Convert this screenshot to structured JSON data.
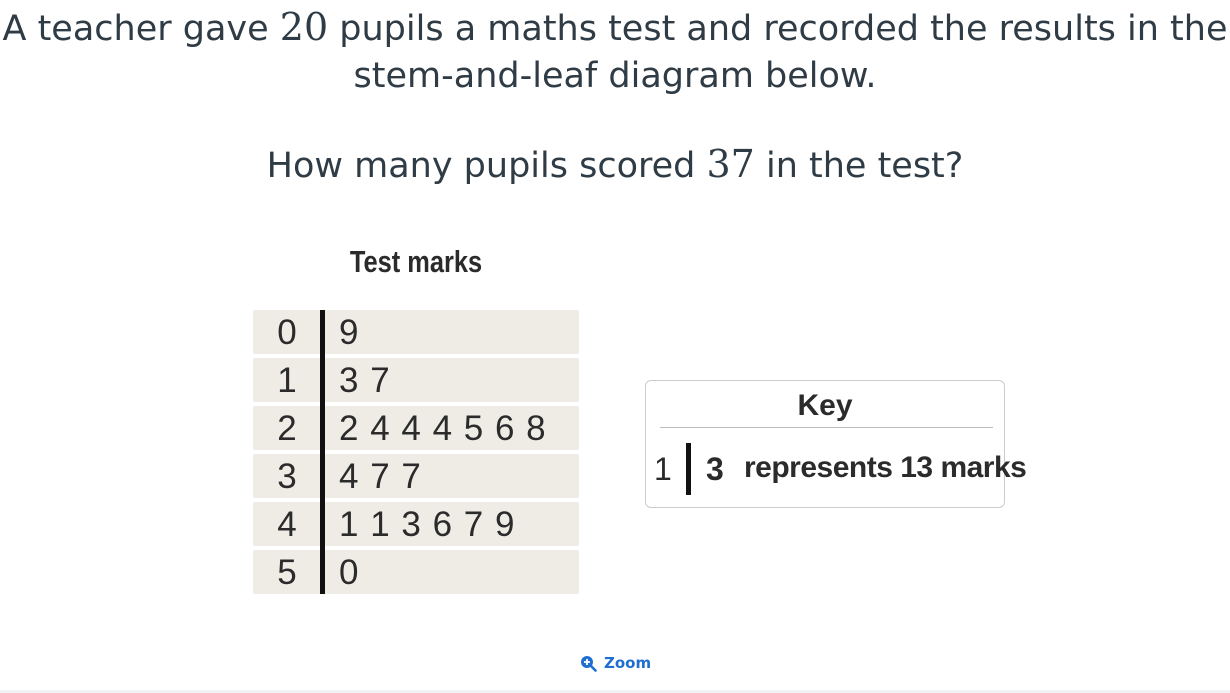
{
  "question": {
    "part1": "A teacher gave ",
    "number": "20",
    "part2": " pupils a maths test and recorded the results in the",
    "line2": "stem-and-leaf diagram below."
  },
  "prompt": {
    "part1": "How many pupils scored ",
    "number": "37",
    "part2": " in the test?"
  },
  "figure": {
    "title": "Test marks",
    "rows": [
      {
        "stem": "0",
        "leaves": "9"
      },
      {
        "stem": "1",
        "leaves": "3 7"
      },
      {
        "stem": "2",
        "leaves": "2 4 4 4 5 6 8"
      },
      {
        "stem": "3",
        "leaves": "4 7 7"
      },
      {
        "stem": "4",
        "leaves": "1 1 3 6 7 9"
      },
      {
        "stem": "5",
        "leaves": "0"
      }
    ]
  },
  "key": {
    "title": "Key",
    "stem": "1",
    "leaf": "3",
    "text": "represents 13 marks"
  },
  "zoom": {
    "label": "Zoom",
    "icon": "zoom-in-icon"
  }
}
